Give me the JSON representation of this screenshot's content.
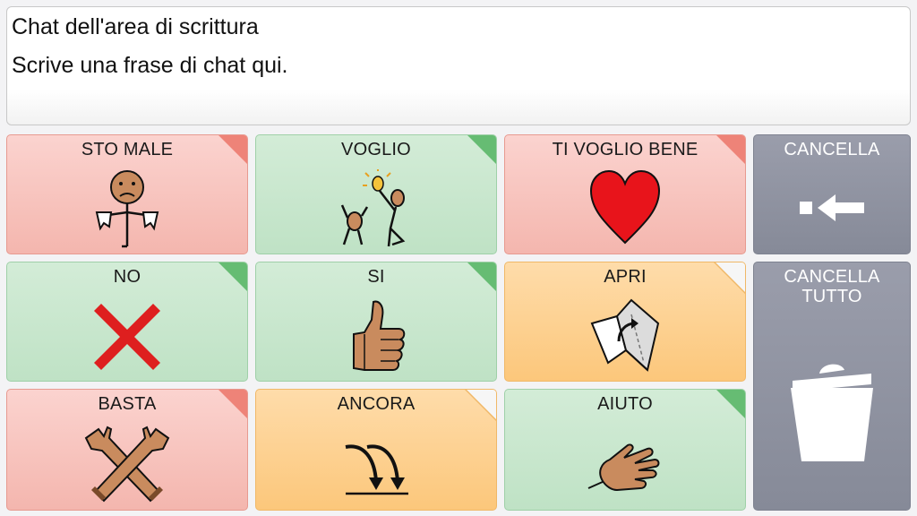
{
  "chat": {
    "title": "Chat dell'area di scrittura",
    "text": "Scrive una frase di chat qui."
  },
  "tiles": {
    "sto_male": {
      "label": "STO MALE",
      "icon": "sick-person-icon",
      "color": "#f4b6ae"
    },
    "voglio": {
      "label": "VOGLIO",
      "icon": "want-idea-icon",
      "color": "#bfe2c5"
    },
    "ti_voglio_bene": {
      "label": "TI VOGLIO BENE",
      "icon": "heart-icon",
      "color": "#f4b6ae"
    },
    "cancella": {
      "label": "CANCELLA",
      "icon": "backspace-icon",
      "color": "#868a98"
    },
    "no": {
      "label": "NO",
      "icon": "red-cross-icon",
      "color": "#bfe2c5"
    },
    "si": {
      "label": "SI",
      "icon": "thumbs-up-icon",
      "color": "#bfe2c5"
    },
    "apri": {
      "label": "APRI",
      "icon": "open-box-icon",
      "color": "#fcc77b"
    },
    "cancella_tutto": {
      "label": "CANCELLA TUTTO",
      "icon": "trash-icon",
      "color": "#868a98"
    },
    "basta": {
      "label": "BASTA",
      "icon": "crossed-arms-icon",
      "color": "#f4b6ae"
    },
    "ancora": {
      "label": "ANCORA",
      "icon": "repeat-arrows-icon",
      "color": "#fcc77b"
    },
    "aiuto": {
      "label": "AIUTO",
      "icon": "helping-hand-icon",
      "color": "#bfe2c5"
    }
  }
}
